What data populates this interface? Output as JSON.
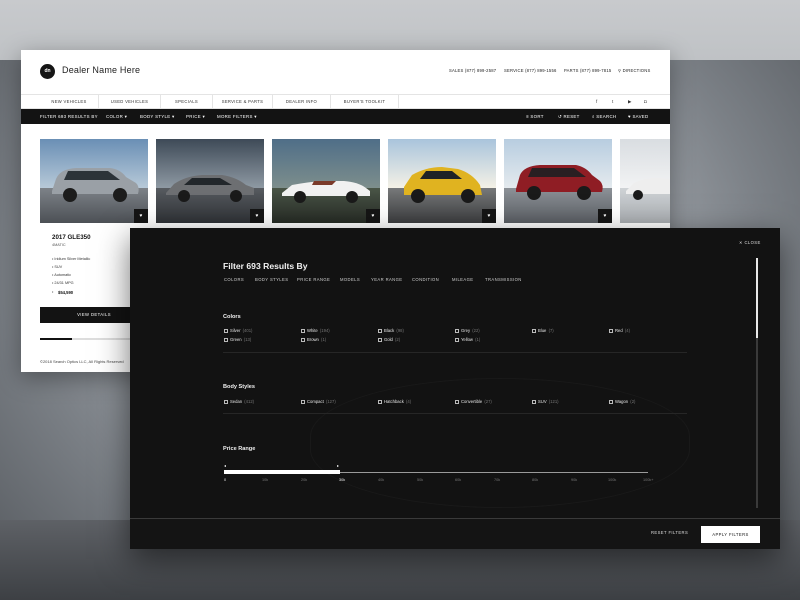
{
  "site": {
    "logo_text": "dn",
    "dealer_name": "Dealer Name Here",
    "contacts": {
      "sales": "SALES (877) 899-2587",
      "service": "SERVICE (877) 899-1556",
      "parts": "PARTS (877) 899-7815",
      "directions": "DIRECTIONS"
    },
    "nav": [
      "NEW VEHICLES",
      "USED VEHICLES",
      "SPECIALS",
      "SERVICE & PARTS",
      "DEALER INFO",
      "BUYER'S TOOLKIT"
    ],
    "social_icons": [
      "facebook-icon",
      "twitter-icon",
      "youtube-icon",
      "instagram-icon"
    ],
    "filterbar": {
      "label": "FILTER 693 RESULTS BY",
      "color": "COLOR",
      "body_style": "BODY STYLE",
      "price": "PRICE",
      "more_filters": "MORE FILTERS",
      "sort": "SORT",
      "reset": "RESET",
      "search": "SEARCH",
      "saved": "SAVED"
    },
    "cars": [
      {
        "color": "#9aa0a6"
      },
      {
        "color": "#6d6f72"
      },
      {
        "color": "#f1f1f1"
      },
      {
        "color": "#e0b320"
      },
      {
        "color": "#8f1d24"
      },
      {
        "color": "#eeeeee"
      }
    ],
    "featured": {
      "title": "2017 GLE350",
      "sub": "4MATIC",
      "specs": [
        "Iridium Silver Metallic",
        "SUV",
        "Automatic",
        "24/31 MPG"
      ],
      "price": "$54,590",
      "cta": "VIEW DETAILS"
    },
    "copyright": "©2018 Search Optics LLC, All Rights Reserved"
  },
  "modal": {
    "close": "CLOSE",
    "title": "Filter 693 Results By",
    "tabs": [
      "COLORS",
      "BODY STYLES",
      "PRICE RANGE",
      "MODELS",
      "YEAR RANGE",
      "CONDITION",
      "MILEAGE",
      "TRANSMISSION"
    ],
    "colors_title": "Colors",
    "colors": [
      {
        "label": "Silver",
        "count": "(401)"
      },
      {
        "label": "White",
        "count": "(194)"
      },
      {
        "label": "Black",
        "count": "(98)"
      },
      {
        "label": "Grey",
        "count": "(22)"
      },
      {
        "label": "Blue",
        "count": "(7)"
      },
      {
        "label": "Red",
        "count": "(4)"
      },
      {
        "label": "Green",
        "count": "(13)"
      },
      {
        "label": "Brown",
        "count": "(1)"
      },
      {
        "label": "Gold",
        "count": "(2)"
      },
      {
        "label": "Yellow",
        "count": "(1)"
      }
    ],
    "body_title": "Body Styles",
    "body_styles": [
      {
        "label": "Sedan",
        "count": "(412)"
      },
      {
        "label": "Compact",
        "count": "(127)"
      },
      {
        "label": "Hatchback",
        "count": "(4)"
      },
      {
        "label": "Convertible",
        "count": "(27)"
      },
      {
        "label": "SUV",
        "count": "(121)"
      },
      {
        "label": "Wagon",
        "count": "(2)"
      }
    ],
    "price_title": "Price Range",
    "price_ticks": [
      "0",
      "10k",
      "20k",
      "30k",
      "40k",
      "50k",
      "60k",
      "70k",
      "80k",
      "90k",
      "100k",
      "100k+"
    ],
    "price_selected_max": "30k",
    "reset": "RESET FILTERS",
    "apply": "APPLY FILTERS"
  }
}
